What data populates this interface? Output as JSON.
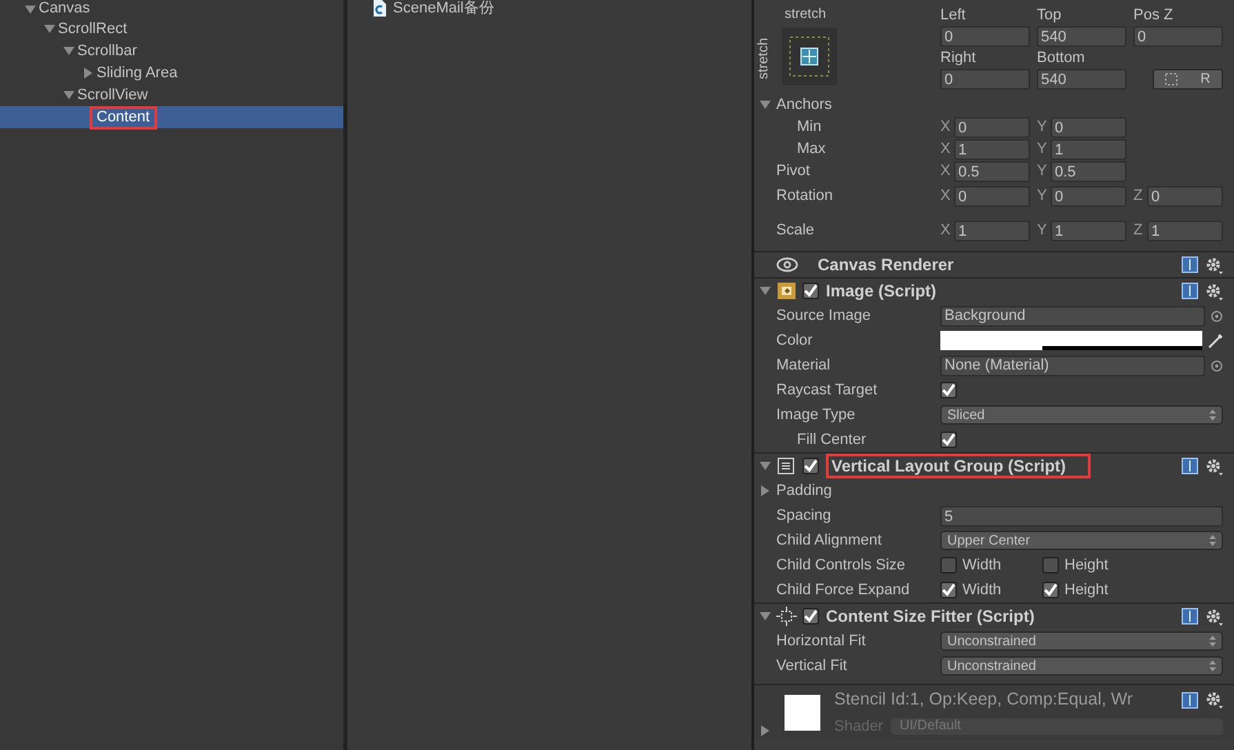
{
  "hierarchy": {
    "items": [
      {
        "name": "Canvas",
        "expanded": true,
        "selected": false,
        "highlighted": false,
        "children": [
          {
            "name": "ScrollRect",
            "expanded": true,
            "selected": false,
            "highlighted": false,
            "children": [
              {
                "name": "Scrollbar",
                "expanded": true,
                "selected": false,
                "highlighted": false,
                "children": [
                  {
                    "name": "Sliding Area",
                    "expanded": false,
                    "selected": false,
                    "highlighted": false
                  }
                ]
              },
              {
                "name": "ScrollView",
                "expanded": true,
                "selected": false,
                "highlighted": false,
                "children": [
                  {
                    "name": "Content",
                    "selected": true,
                    "highlighted": true
                  }
                ]
              }
            ]
          }
        ]
      }
    ]
  },
  "project": {
    "items": [
      {
        "name": "SceneMail备份"
      }
    ]
  },
  "inspector": {
    "rect_transform": {
      "preset_horizontal": "stretch",
      "preset_vertical": "stretch",
      "fields": [
        {
          "label": "Left",
          "value": "0"
        },
        {
          "label": "Top",
          "value": "540"
        },
        {
          "label": "Pos Z",
          "value": "0"
        },
        {
          "label": "Right",
          "value": "0"
        },
        {
          "label": "Bottom",
          "value": "540"
        }
      ],
      "raw_button": "R",
      "rows": [
        {
          "kind": "foldout",
          "label": "Anchors",
          "expanded": true,
          "children": [
            {
              "kind": "vector",
              "label": "Min",
              "axes": [
                {
                  "axis": "X",
                  "value": "0"
                },
                {
                  "axis": "Y",
                  "value": "0"
                }
              ]
            },
            {
              "kind": "vector",
              "label": "Max",
              "axes": [
                {
                  "axis": "X",
                  "value": "1"
                },
                {
                  "axis": "Y",
                  "value": "1"
                }
              ]
            }
          ]
        },
        {
          "kind": "vector",
          "label": "Pivot",
          "axes": [
            {
              "axis": "X",
              "value": "0.5"
            },
            {
              "axis": "Y",
              "value": "0.5"
            }
          ]
        },
        {
          "kind": "vector",
          "label": "Rotation",
          "axes": [
            {
              "axis": "X",
              "value": "0"
            },
            {
              "axis": "Y",
              "value": "0"
            },
            {
              "axis": "Z",
              "value": "0"
            }
          ]
        },
        {
          "kind": "vector",
          "label": "Scale",
          "axes": [
            {
              "axis": "X",
              "value": "1"
            },
            {
              "axis": "Y",
              "value": "1"
            },
            {
              "axis": "Z",
              "value": "1"
            }
          ]
        }
      ]
    },
    "components": [
      {
        "title": "Canvas Renderer",
        "kind": "eye",
        "highlighted": false
      },
      {
        "title": "Image (Script)",
        "kind": "image",
        "enabled": true,
        "expanded": true,
        "highlighted": false,
        "rows": [
          {
            "kind": "object",
            "label": "Source Image",
            "value": "Background"
          },
          {
            "kind": "color",
            "label": "Color",
            "level": 0.39
          },
          {
            "kind": "object",
            "label": "Material",
            "value": "None (Material)"
          },
          {
            "kind": "checkbox",
            "label": "Raycast Target",
            "checked": true
          },
          {
            "kind": "dropdown",
            "label": "Image Type",
            "value": "Sliced",
            "children": [
              {
                "kind": "checkbox",
                "label": "Fill Center",
                "checked": true
              }
            ]
          }
        ]
      },
      {
        "title": "Vertical Layout Group (Script)",
        "kind": "layout",
        "enabled": true,
        "expanded": true,
        "highlighted": true,
        "rows": [
          {
            "kind": "foldout",
            "label": "Padding",
            "expanded": false
          },
          {
            "kind": "field",
            "label": "Spacing",
            "value": "5"
          },
          {
            "kind": "dropdown",
            "label": "Child Alignment",
            "value": "Upper Center"
          },
          {
            "kind": "toggles",
            "label": "Child Controls Size",
            "options": [
              {
                "label": "Width",
                "checked": false
              },
              {
                "label": "Height",
                "checked": false
              }
            ]
          },
          {
            "kind": "toggles",
            "label": "Child Force Expand",
            "options": [
              {
                "label": "Width",
                "checked": true
              },
              {
                "label": "Height",
                "checked": true
              }
            ]
          }
        ]
      },
      {
        "title": "Content Size Fitter (Script)",
        "kind": "fitter",
        "enabled": true,
        "expanded": true,
        "highlighted": false,
        "rows": [
          {
            "kind": "dropdown",
            "label": "Horizontal Fit",
            "value": "Unconstrained"
          },
          {
            "kind": "dropdown",
            "label": "Vertical Fit",
            "value": "Unconstrained"
          }
        ]
      }
    ],
    "material": {
      "description": "Stencil Id:1, Op:Keep, Comp:Equal, Wr",
      "shader_label": "Shader",
      "shader": "UI/Default",
      "expanded": false
    }
  }
}
